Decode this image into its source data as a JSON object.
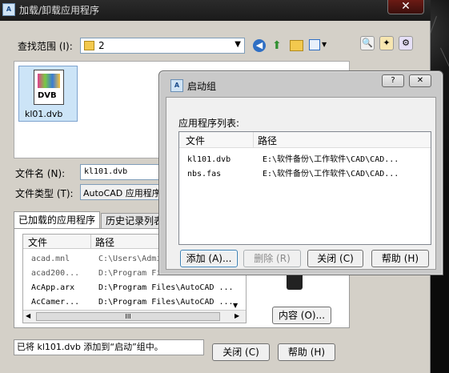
{
  "main": {
    "title": "加载/卸载应用程序",
    "close_glyph": "✕",
    "lookin_label": "查找范围 (I):",
    "lookin_value": "2",
    "file_item_label": "kl01.dvb",
    "file_item_icon_text": "DVB",
    "filename_label": "文件名 (N):",
    "filename_value": "kl101.dvb",
    "filetype_label": "文件类型 (T):",
    "filetype_value": "AutoCAD 应用程序",
    "tabs": [
      "已加载的应用程序",
      "历史记录列表"
    ],
    "loaded_columns": [
      "文件",
      "路径"
    ],
    "loaded_rows": [
      {
        "file": "acad.mnl",
        "path": "C:\\Users\\Admi"
      },
      {
        "file": "acad200...",
        "path": "D:\\Program Fi"
      },
      {
        "file": "AcApp.arx",
        "path": "D:\\Program Files\\AutoCAD ..."
      },
      {
        "file": "AcCamer...",
        "path": "D:\\Program Files\\AutoCAD ..."
      }
    ],
    "hscroll_thumb": "III",
    "contents_button": "内容 (O)...",
    "status_text": "已将 kl101.dvb 添加到“启动”组中。",
    "close_button": "关闭 (C)",
    "help_button": "帮助 (H)"
  },
  "startup": {
    "title": "启动组",
    "help_glyph": "?",
    "close_glyph": "✕",
    "list_label": "应用程序列表:",
    "columns": [
      "文件",
      "路径"
    ],
    "rows": [
      {
        "file": "kl101.dvb",
        "path": "E:\\软件备份\\工作软件\\CAD\\CAD..."
      },
      {
        "file": "nbs.fas",
        "path": "E:\\软件备份\\工作软件\\CAD\\CAD..."
      }
    ],
    "add_button": "添加 (A)...",
    "remove_button": "删除 (R)",
    "close_button": "关闭 (C)",
    "help_button": "帮助 (H)"
  }
}
